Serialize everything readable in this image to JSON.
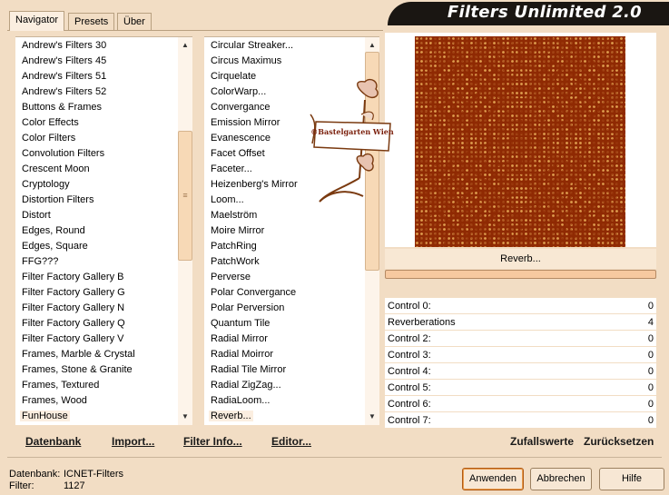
{
  "tabs": [
    {
      "label": "Navigator",
      "active": true
    },
    {
      "label": "Presets",
      "active": false
    },
    {
      "label": "Über",
      "active": false
    }
  ],
  "app_title": "Filters Unlimited 2.0",
  "watermark": "©Bastelgarten Wien",
  "categories": [
    "Andrew's Filters 30",
    "Andrew's Filters 45",
    "Andrew's Filters 51",
    "Andrew's Filters 52",
    "Buttons & Frames",
    "Color Effects",
    "Color Filters",
    "Convolution Filters",
    "Crescent Moon",
    "Cryptology",
    "Distortion Filters",
    "Distort",
    "Edges, Round",
    "Edges, Square",
    "FFG???",
    "Filter Factory Gallery B",
    "Filter Factory Gallery G",
    "Filter Factory Gallery N",
    "Filter Factory Gallery Q",
    "Filter Factory Gallery V",
    "Frames, Marble & Crystal",
    "Frames, Stone & Granite",
    "Frames, Textured",
    "Frames, Wood",
    "FunHouse"
  ],
  "selected_category": "FunHouse",
  "filters": [
    "Circular Streaker...",
    "Circus Maximus",
    "Cirquelate",
    "ColorWarp...",
    "Convergance",
    "Emission Mirror",
    "Evanescence",
    "Facet Offset",
    "Faceter...",
    "Heizenberg's Mirror",
    "Loom...",
    "Maelström",
    "Moire Mirror",
    "PatchRing",
    "PatchWork",
    "Perverse",
    "Polar Convergance",
    "Polar Perversion",
    "Quantum Tile",
    "Radial Mirror",
    "Radial Moirror",
    "Radial Tile Mirror",
    "Radial ZigZag...",
    "RadiaLoom...",
    "Reverb..."
  ],
  "selected_filter": "Reverb...",
  "current_filter_label": "Reverb...",
  "controls": [
    {
      "label": "Control 0:",
      "value": "0"
    },
    {
      "label": "Reverberations",
      "value": "4"
    },
    {
      "label": "Control 2:",
      "value": "0"
    },
    {
      "label": "Control 3:",
      "value": "0"
    },
    {
      "label": "Control 4:",
      "value": "0"
    },
    {
      "label": "Control 5:",
      "value": "0"
    },
    {
      "label": "Control 6:",
      "value": "0"
    },
    {
      "label": "Control 7:",
      "value": "0"
    }
  ],
  "toolbar_left": [
    {
      "label": "Datenbank",
      "name": "datenbank-link"
    },
    {
      "label": "Import...",
      "name": "import-link"
    },
    {
      "label": "Filter Info...",
      "name": "filter-info-link"
    },
    {
      "label": "Editor...",
      "name": "editor-link"
    }
  ],
  "toolbar_right": [
    {
      "label": "Zufallswerte",
      "name": "zufallswerte-link"
    },
    {
      "label": "Zurücksetzen",
      "name": "zuruecksetzen-link"
    }
  ],
  "status": {
    "db_label": "Datenbank:",
    "db_value": "ICNET-Filters",
    "filter_label": "Filter:",
    "filter_value": "1127"
  },
  "buttons": {
    "apply": "Anwenden",
    "cancel": "Abbrechen",
    "help": "Hilfe"
  },
  "colors": {
    "window_bg": "#f2ddc4",
    "preview_dark": "#8f2a04",
    "preview_light": "#e0a050"
  }
}
